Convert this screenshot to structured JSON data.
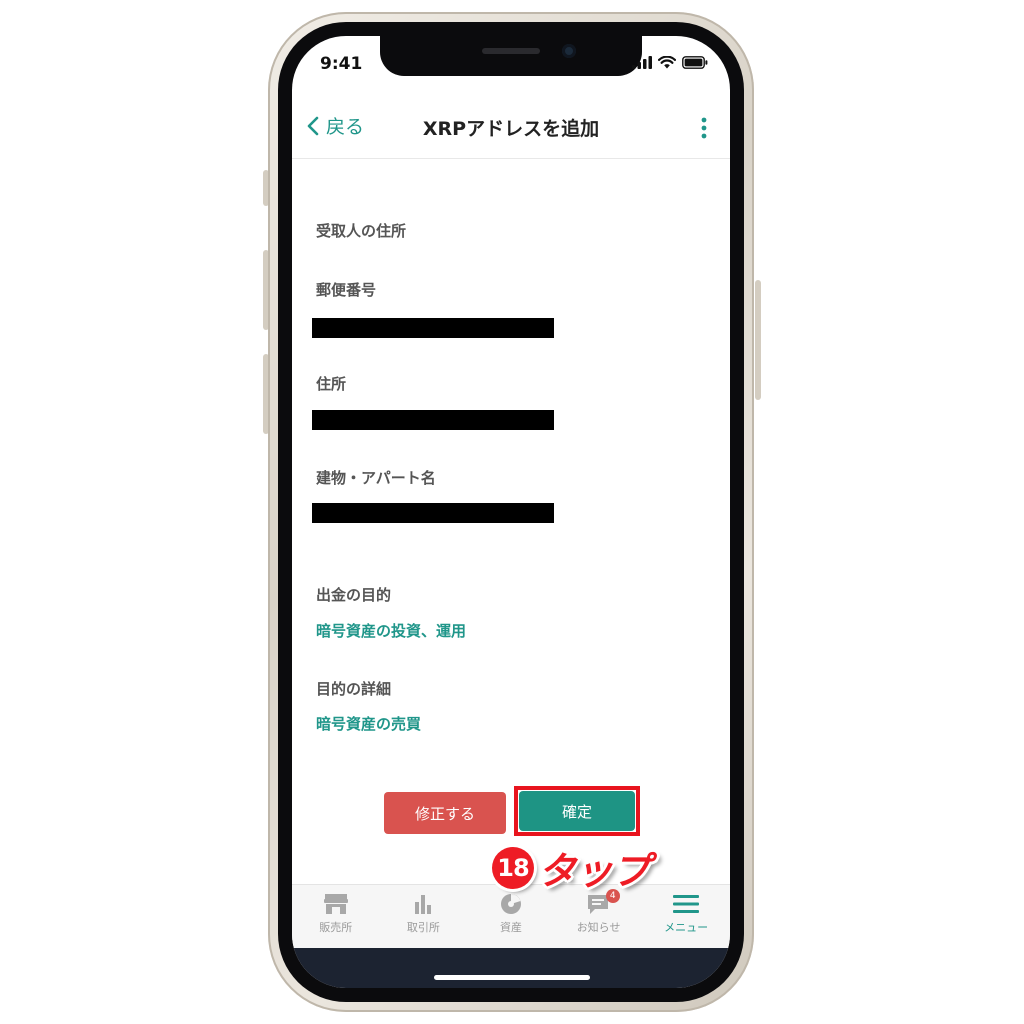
{
  "status_bar": {
    "time": "9:41"
  },
  "nav": {
    "back_label": "戻る",
    "title": "XRPアドレスを追加"
  },
  "form": {
    "recipient_address_heading": "受取人の住所",
    "postal_code_label": "郵便番号",
    "address_label": "住所",
    "building_label": "建物・アパート名",
    "purpose_label": "出金の目的",
    "purpose_value": "暗号資産の投資、運用",
    "purpose_detail_label": "目的の詳細",
    "purpose_detail_value": "暗号資産の売買"
  },
  "actions": {
    "fix_label": "修正する",
    "confirm_label": "確定"
  },
  "callout": {
    "number": "18",
    "text": "タップ"
  },
  "tabbar": {
    "items": [
      {
        "label": "販売所",
        "icon": "store-icon"
      },
      {
        "label": "取引所",
        "icon": "bar-chart-icon"
      },
      {
        "label": "資産",
        "icon": "pie-chart-icon"
      },
      {
        "label": "お知らせ",
        "icon": "message-icon",
        "badge": "4"
      },
      {
        "label": "メニュー",
        "icon": "hamburger-menu-icon"
      }
    ],
    "active_index": 4
  },
  "colors": {
    "accent": "#20968a",
    "fix_button": "#d9534f",
    "confirm_button": "#1e9484",
    "highlight": "#e8141e"
  }
}
